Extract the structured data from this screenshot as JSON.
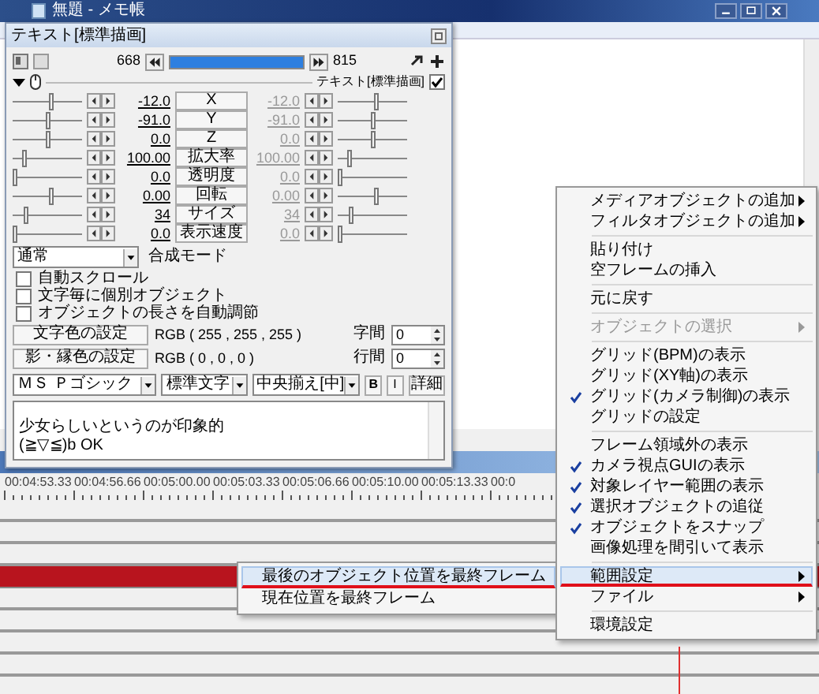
{
  "notepad": {
    "title": "無題 - メモ帳"
  },
  "dialog": {
    "title": "テキスト[標準描画]",
    "frame_start": "668",
    "frame_end": "815",
    "level": 1,
    "object": {
      "label": "テキスト[標準描画]",
      "checked": true
    },
    "params": [
      {
        "label": "X",
        "start": {
          "value": "-12.0",
          "level": 0.55
        },
        "end": {
          "value": "-12.0",
          "level": 0.55,
          "disabled": true
        }
      },
      {
        "label": "Y",
        "start": {
          "value": "-91.0",
          "level": 0.5
        },
        "end": {
          "value": "-91.0",
          "level": 0.5,
          "disabled": true
        }
      },
      {
        "label": "Z",
        "start": {
          "value": "0.0",
          "level": 0.5
        },
        "end": {
          "value": "0.0",
          "level": 0.5,
          "disabled": true
        }
      },
      {
        "label": "拡大率",
        "start": {
          "value": "100.00",
          "level": 0.15
        },
        "end": {
          "value": "100.00",
          "level": 0.15,
          "disabled": true
        }
      },
      {
        "label": "透明度",
        "start": {
          "value": "0.0",
          "level": 0
        },
        "end": {
          "value": "0.0",
          "level": 0,
          "disabled": true
        }
      },
      {
        "label": "回転",
        "start": {
          "value": "0.00",
          "level": 0.55
        },
        "end": {
          "value": "0.00",
          "level": 0.55,
          "disabled": true
        }
      },
      {
        "label": "サイズ",
        "start": {
          "value": "34",
          "level": 0.18
        },
        "end": {
          "value": "34",
          "level": 0.18,
          "disabled": true
        }
      },
      {
        "label": "表示速度",
        "start": {
          "value": "0.0",
          "level": 0
        },
        "end": {
          "value": "0.0",
          "level": 0,
          "disabled": true
        }
      }
    ],
    "blend": {
      "value": "通常",
      "label": "合成モード"
    },
    "checkboxes": [
      {
        "label": "自動スクロール",
        "checked": false
      },
      {
        "label": "文字毎に個別オブジェクト",
        "checked": false
      },
      {
        "label": "オブジェクトの長さを自動調節",
        "checked": false
      }
    ],
    "colors": [
      {
        "button": "文字色の設定",
        "value": "RGB ( 255 , 255 , 255 )",
        "spacing_label": "字間",
        "spacing_value": "0"
      },
      {
        "button": "影・縁色の設定",
        "value": "RGB ( 0 , 0 , 0 )",
        "spacing_label": "行間",
        "spacing_value": "0"
      }
    ],
    "font": {
      "family": "ＭＳ Ｐゴシック",
      "style": "標準文字",
      "align": "中央揃え[中]",
      "bold": "B",
      "italic": "I",
      "details": "詳細"
    },
    "text_lines": [
      "少女らしいというのが印象的",
      "(≧▽≦)b OK"
    ]
  },
  "timeline": {
    "ticks": [
      "00:04:53.33",
      "00:04:56.66",
      "00:05:00.00",
      "00:05:03.33",
      "00:05:06.66",
      "00:05:10.00",
      "00:05:13.33",
      "00:0"
    ],
    "lanes": [
      {
        "kind": "empty"
      },
      {
        "kind": "empty"
      },
      {
        "kind": "empty"
      },
      {
        "kind": "object"
      },
      {
        "kind": "empty"
      },
      {
        "kind": "empty"
      },
      {
        "kind": "empty"
      },
      {
        "kind": "empty"
      }
    ]
  },
  "menu": {
    "items": [
      {
        "kind": "item",
        "label": "メディアオブジェクトの追加",
        "submenu": true,
        "checked": false,
        "disabled": false,
        "highlighted": false,
        "underlined": false
      },
      {
        "kind": "item",
        "label": "フィルタオブジェクトの追加",
        "submenu": true,
        "checked": false,
        "disabled": false,
        "highlighted": false,
        "underlined": false
      },
      {
        "kind": "separator"
      },
      {
        "kind": "item",
        "label": "貼り付け",
        "submenu": false,
        "checked": false,
        "disabled": false,
        "highlighted": false,
        "underlined": false
      },
      {
        "kind": "item",
        "label": "空フレームの挿入",
        "submenu": false,
        "checked": false,
        "disabled": false,
        "highlighted": false,
        "underlined": false
      },
      {
        "kind": "separator"
      },
      {
        "kind": "item",
        "label": "元に戻す",
        "submenu": false,
        "checked": false,
        "disabled": false,
        "highlighted": false,
        "underlined": false
      },
      {
        "kind": "separator"
      },
      {
        "kind": "item",
        "label": "オブジェクトの選択",
        "submenu": true,
        "checked": false,
        "disabled": true,
        "highlighted": false,
        "underlined": false
      },
      {
        "kind": "separator"
      },
      {
        "kind": "item",
        "label": "グリッド(BPM)の表示",
        "submenu": false,
        "checked": false,
        "disabled": false,
        "highlighted": false,
        "underlined": false
      },
      {
        "kind": "item",
        "label": "グリッド(XY軸)の表示",
        "submenu": false,
        "checked": false,
        "disabled": false,
        "highlighted": false,
        "underlined": false
      },
      {
        "kind": "item",
        "label": "グリッド(カメラ制御)の表示",
        "submenu": false,
        "checked": true,
        "disabled": false,
        "highlighted": false,
        "underlined": false
      },
      {
        "kind": "item",
        "label": "グリッドの設定",
        "submenu": false,
        "checked": false,
        "disabled": false,
        "highlighted": false,
        "underlined": false
      },
      {
        "kind": "separator"
      },
      {
        "kind": "item",
        "label": "フレーム領域外の表示",
        "submenu": false,
        "checked": false,
        "disabled": false,
        "highlighted": false,
        "underlined": false
      },
      {
        "kind": "item",
        "label": "カメラ視点GUIの表示",
        "submenu": false,
        "checked": true,
        "disabled": false,
        "highlighted": false,
        "underlined": false
      },
      {
        "kind": "item",
        "label": "対象レイヤー範囲の表示",
        "submenu": false,
        "checked": true,
        "disabled": false,
        "highlighted": false,
        "underlined": false
      },
      {
        "kind": "item",
        "label": "選択オブジェクトの追従",
        "submenu": false,
        "checked": true,
        "disabled": false,
        "highlighted": false,
        "underlined": false
      },
      {
        "kind": "item",
        "label": "オブジェクトをスナップ",
        "submenu": false,
        "checked": true,
        "disabled": false,
        "highlighted": false,
        "underlined": false
      },
      {
        "kind": "item",
        "label": "画像処理を間引いて表示",
        "submenu": false,
        "checked": false,
        "disabled": false,
        "highlighted": false,
        "underlined": false
      },
      {
        "kind": "separator"
      },
      {
        "kind": "item",
        "label": "範囲設定",
        "submenu": true,
        "checked": false,
        "disabled": false,
        "highlighted": true,
        "underlined": true
      },
      {
        "kind": "item",
        "label": "ファイル",
        "submenu": true,
        "checked": false,
        "disabled": false,
        "highlighted": false,
        "underlined": false
      },
      {
        "kind": "separator"
      },
      {
        "kind": "item",
        "label": "環境設定",
        "submenu": false,
        "checked": false,
        "disabled": false,
        "highlighted": false,
        "underlined": false
      }
    ]
  },
  "submenu": {
    "items": [
      {
        "label": "最後のオブジェクト位置を最終フレーム",
        "highlighted": true,
        "underlined": true
      },
      {
        "label": "現在位置を最終フレーム",
        "highlighted": false,
        "underlined": false
      }
    ]
  }
}
